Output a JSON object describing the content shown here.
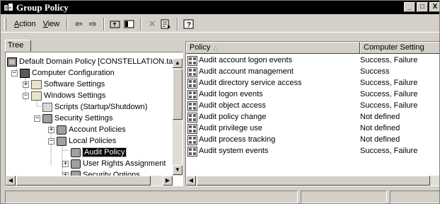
{
  "window": {
    "title": "Group Policy"
  },
  "menu": {
    "action_pre": "A",
    "action_rest": "ction",
    "view_pre": "V",
    "view_rest": "iew"
  },
  "toolbar_icons": [
    "back-arrow-icon",
    "forward-arrow-icon",
    "up-folder-icon",
    "show-hide-tree-icon",
    "delete-icon",
    "export-list-icon",
    "help-icon"
  ],
  "tree": {
    "tab_label": "Tree",
    "items": [
      {
        "label": "Default Domain Policy [CONSTELLATION.tac",
        "icon": "policy-icon"
      },
      {
        "label": "Computer Configuration",
        "icon": "computer-icon"
      },
      {
        "label": "Software Settings",
        "icon": "folder-icon"
      },
      {
        "label": "Windows Settings",
        "icon": "folder-icon"
      },
      {
        "label": "Scripts (Startup/Shutdown)",
        "icon": "scroll-icon"
      },
      {
        "label": "Security Settings",
        "icon": "security-settings-icon"
      },
      {
        "label": "Account Policies",
        "icon": "gear-icon"
      },
      {
        "label": "Local Policies",
        "icon": "gear-icon"
      },
      {
        "label": "Audit Policy",
        "icon": "gear-icon",
        "selected": true
      },
      {
        "label": "User Rights Assignment",
        "icon": "gear-icon"
      },
      {
        "label": "Security Options",
        "icon": "gear-icon"
      }
    ]
  },
  "list": {
    "columns": [
      "Policy",
      "Computer Setting"
    ],
    "sort_indicator": "△",
    "rows": [
      {
        "policy": "Audit account logon events",
        "setting": "Success, Failure"
      },
      {
        "policy": "Audit account management",
        "setting": "Success"
      },
      {
        "policy": "Audit directory service access",
        "setting": "Success, Failure"
      },
      {
        "policy": "Audit logon events",
        "setting": "Success, Failure"
      },
      {
        "policy": "Audit object access",
        "setting": "Success, Failure"
      },
      {
        "policy": "Audit policy change",
        "setting": "Not defined"
      },
      {
        "policy": "Audit privilege use",
        "setting": "Not defined"
      },
      {
        "policy": "Audit process tracking",
        "setting": "Not defined"
      },
      {
        "policy": "Audit system events",
        "setting": "Success, Failure"
      }
    ]
  },
  "glyphs": {
    "minimize": "_",
    "maximize": "□",
    "close": "X",
    "back": "⇦",
    "forward": "⇨",
    "delete": "✕",
    "help": "?",
    "expand_plus": "+",
    "collapse_minus": "−"
  }
}
